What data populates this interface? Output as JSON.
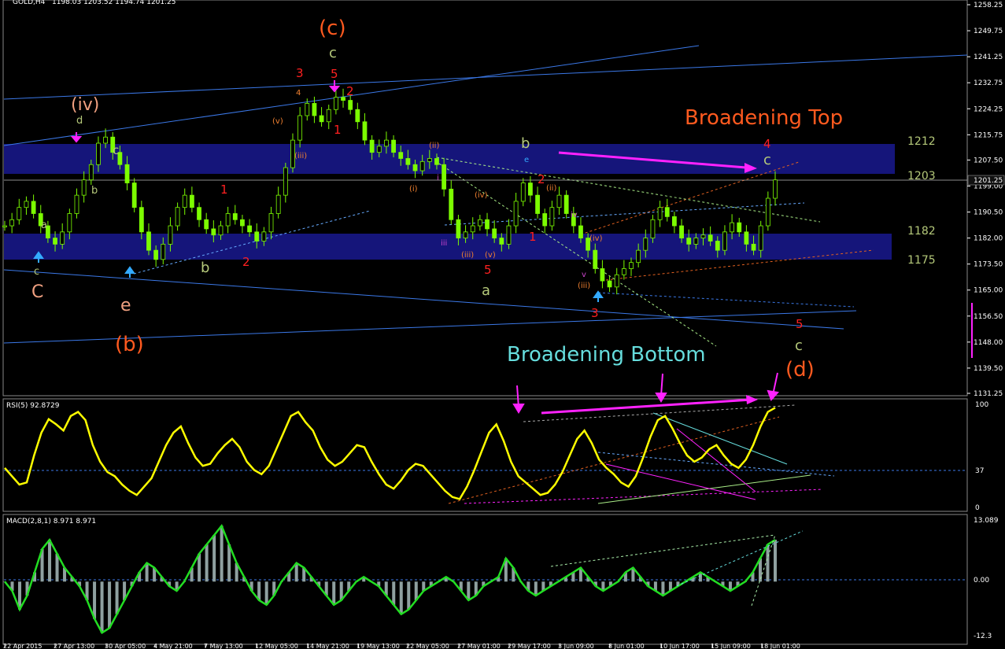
{
  "header": {
    "symbol": "GOLD,H4",
    "ohlc": "1198.03 1203.52 1194.74 1201.25",
    "rsi_label": "RSI(5) 92.8729",
    "macd_label": "MACD(2,8,1) 8.971 8.971"
  },
  "colors": {
    "background": "#000000",
    "candles": "#7CFC00",
    "zone": "#15157a",
    "rsi_line": "#FFFF00",
    "macd_line": "#22DD22",
    "histogram": "#8FA0A0",
    "channel": "#3B78E7",
    "magenta": "#FF22FF"
  },
  "chart_data": [
    {
      "type": "candlestick",
      "panel": "price",
      "y_ticks": [
        "1258.25",
        "1249.75",
        "1241.25",
        "1232.75",
        "1224.25",
        "1215.75",
        "1207.50",
        "1199.00",
        "1190.50",
        "1182.00",
        "1173.50",
        "1165.00",
        "1156.50",
        "1148.00",
        "1139.50",
        "1131.25"
      ],
      "ylim": [
        1131.25,
        1258.25
      ],
      "current_price": "1201.25",
      "x_ticks": [
        "22 Apr 2015",
        "27 Apr 13:00",
        "30 Apr 05:00",
        "4 May 21:00",
        "7 May 13:00",
        "12 May 05:00",
        "14 May 21:00",
        "19 May 13:00",
        "22 May 05:00",
        "27 May 01:00",
        "29 May 17:00",
        "3 Jun 09:00",
        "8 Jun 01:00",
        "10 Jun 17:00",
        "15 Jun 09:00",
        "18 Jun 01:00"
      ],
      "close_series": [
        1186,
        1188,
        1192,
        1194,
        1190,
        1186,
        1182,
        1180,
        1184,
        1190,
        1196,
        1201,
        1206,
        1213,
        1215,
        1210,
        1206,
        1200,
        1192,
        1184,
        1178,
        1175,
        1180,
        1186,
        1192,
        1196,
        1192,
        1188,
        1185,
        1183,
        1186,
        1190,
        1188,
        1186,
        1184,
        1181,
        1184,
        1190,
        1196,
        1205,
        1214,
        1222,
        1226,
        1222,
        1220,
        1224,
        1228,
        1227,
        1224,
        1220,
        1214,
        1210,
        1212,
        1214,
        1210,
        1208,
        1206,
        1204,
        1207,
        1208,
        1206,
        1198,
        1188,
        1182,
        1184,
        1186,
        1188,
        1185,
        1182,
        1180,
        1186,
        1194,
        1200,
        1196,
        1190,
        1186,
        1192,
        1196,
        1190,
        1186,
        1182,
        1178,
        1172,
        1168,
        1166,
        1170,
        1172,
        1174,
        1178,
        1182,
        1188,
        1192,
        1189,
        1186,
        1182,
        1180,
        1182,
        1183,
        1181,
        1178,
        1184,
        1187,
        1184,
        1180,
        1178,
        1186,
        1195,
        1201
      ],
      "zones": [
        {
          "label": "1212",
          "value": 1212
        },
        {
          "label": "1203",
          "value": 1203
        },
        {
          "label": "1182",
          "value": 1182
        },
        {
          "label": "1175",
          "value": 1175
        }
      ],
      "annotations": [
        "(c)",
        "c",
        "3",
        "5",
        "2",
        "1",
        "4",
        "(v)",
        "(iii)",
        "(iv)",
        "d",
        "c",
        "b",
        "a",
        "c",
        "e",
        "(b)",
        "C",
        "Broadening Top",
        "4",
        "c",
        "b",
        "e",
        "2",
        "(ii)",
        "(iv)",
        "iv",
        "i",
        "1",
        "5",
        "(v)",
        "(iii)",
        "iii",
        "(i)",
        "(ii)",
        "a",
        "b",
        "(iv)",
        "(iii)",
        "v",
        "3",
        "5",
        "c",
        "(d)",
        "Broadening Bottom",
        "1",
        "2"
      ]
    },
    {
      "type": "line",
      "panel": "rsi",
      "name": "RSI(5)",
      "ylim": [
        0,
        100
      ],
      "y_ticks": [
        "100",
        "37",
        "0"
      ],
      "values": [
        38,
        30,
        22,
        24,
        50,
        72,
        85,
        80,
        74,
        88,
        92,
        84,
        60,
        44,
        34,
        30,
        22,
        16,
        12,
        20,
        28,
        44,
        60,
        72,
        78,
        62,
        48,
        40,
        42,
        52,
        60,
        66,
        58,
        44,
        36,
        32,
        40,
        56,
        72,
        88,
        92,
        82,
        74,
        58,
        46,
        40,
        44,
        52,
        60,
        58,
        44,
        32,
        22,
        18,
        26,
        36,
        42,
        40,
        32,
        24,
        16,
        10,
        8,
        20,
        36,
        54,
        72,
        80,
        64,
        44,
        30,
        24,
        18,
        12,
        14,
        22,
        34,
        50,
        66,
        74,
        62,
        46,
        38,
        32,
        24,
        20,
        30,
        48,
        68,
        84,
        88,
        76,
        62,
        50,
        44,
        48,
        56,
        60,
        50,
        42,
        38,
        46,
        60,
        78,
        92,
        96
      ]
    },
    {
      "type": "bar",
      "panel": "macd",
      "name": "MACD(2,8,1)",
      "ylim": [
        -12.3,
        13.089
      ],
      "y_ticks": [
        "13.089",
        "0.00",
        "-12.3"
      ],
      "values": [
        0,
        -2,
        -6,
        -3,
        2,
        7,
        9,
        6,
        3,
        1,
        -1,
        -4,
        -8,
        -11,
        -10,
        -7,
        -4,
        -1,
        2,
        4,
        3,
        1,
        -1,
        -2,
        0,
        3,
        6,
        8,
        10,
        12,
        8,
        4,
        1,
        -2,
        -4,
        -5,
        -3,
        0,
        2,
        4,
        3,
        1,
        -1,
        -3,
        -5,
        -4,
        -2,
        0,
        1,
        0,
        -1,
        -3,
        -5,
        -7,
        -6,
        -4,
        -2,
        -1,
        0,
        1,
        0,
        -2,
        -4,
        -3,
        -1,
        0,
        1,
        5,
        3,
        0,
        -2,
        -3,
        -2,
        -1,
        0,
        1,
        2,
        3,
        1,
        -1,
        -2,
        -1,
        0,
        2,
        3,
        1,
        -1,
        -2,
        -3,
        -2,
        -1,
        0,
        1,
        2,
        1,
        0,
        -1,
        -2,
        -1,
        0,
        2,
        5,
        8,
        9
      ]
    }
  ]
}
